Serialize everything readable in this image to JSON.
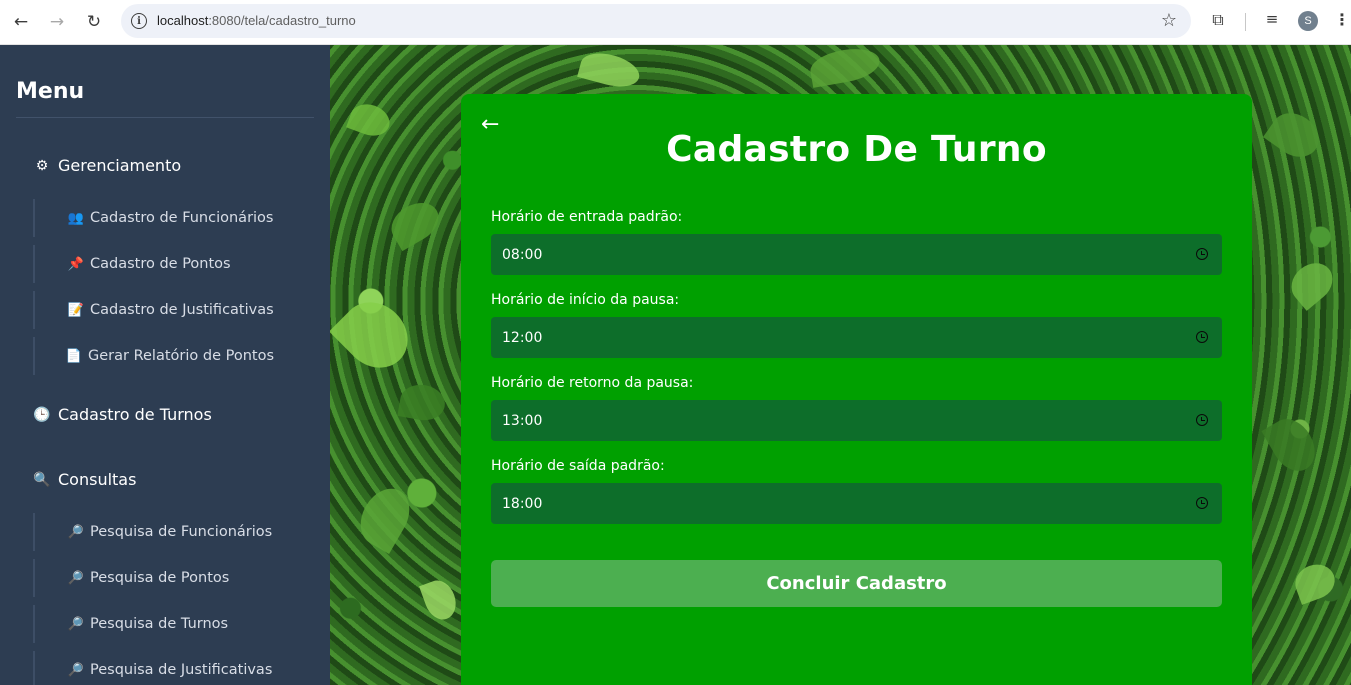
{
  "browser": {
    "url_host": "localhost",
    "url_rest": ":8080/tela/cadastro_turno",
    "profile_initial": "S",
    "icons": [
      "back-icon",
      "forward-icon",
      "reload-icon",
      "info-icon",
      "star-icon",
      "extensions-icon",
      "media-icon",
      "kebab-menu-icon"
    ]
  },
  "sidebar": {
    "title": "Menu",
    "sections": [
      {
        "label": "Gerenciamento",
        "icon": "⚙",
        "items": [
          {
            "label": "Cadastro de Funcionários",
            "icon": "👥"
          },
          {
            "label": "Cadastro de Pontos",
            "icon": "📌"
          },
          {
            "label": "Cadastro de Justificativas",
            "icon": "📝"
          },
          {
            "label": "Gerar Relatório de Pontos",
            "icon": "📄"
          }
        ]
      },
      {
        "label": "Cadastro de Turnos",
        "icon": "🕒",
        "items": []
      },
      {
        "label": "Consultas",
        "icon": "🔍",
        "items": [
          {
            "label": "Pesquisa de Funcionários",
            "icon": "🔎"
          },
          {
            "label": "Pesquisa de Pontos",
            "icon": "🔎"
          },
          {
            "label": "Pesquisa de Turnos",
            "icon": "🔎"
          },
          {
            "label": "Pesquisa de Justificativas",
            "icon": "🔎"
          }
        ]
      }
    ]
  },
  "form": {
    "back_arrow": "←",
    "title": "Cadastro De Turno",
    "fields": [
      {
        "label": "Horário de entrada padrão:",
        "value": "08:00"
      },
      {
        "label": "Horário de início da pausa:",
        "value": "12:00"
      },
      {
        "label": "Horário de retorno da pausa:",
        "value": "13:00"
      },
      {
        "label": "Horário de saída padrão:",
        "value": "18:00"
      }
    ],
    "submit_label": "Concluir Cadastro"
  },
  "colors": {
    "sidebar_bg": "#2d3d52",
    "card_bg": "#00a000",
    "input_bg": "#0d6e2a",
    "button_bg": "#4caf50"
  }
}
